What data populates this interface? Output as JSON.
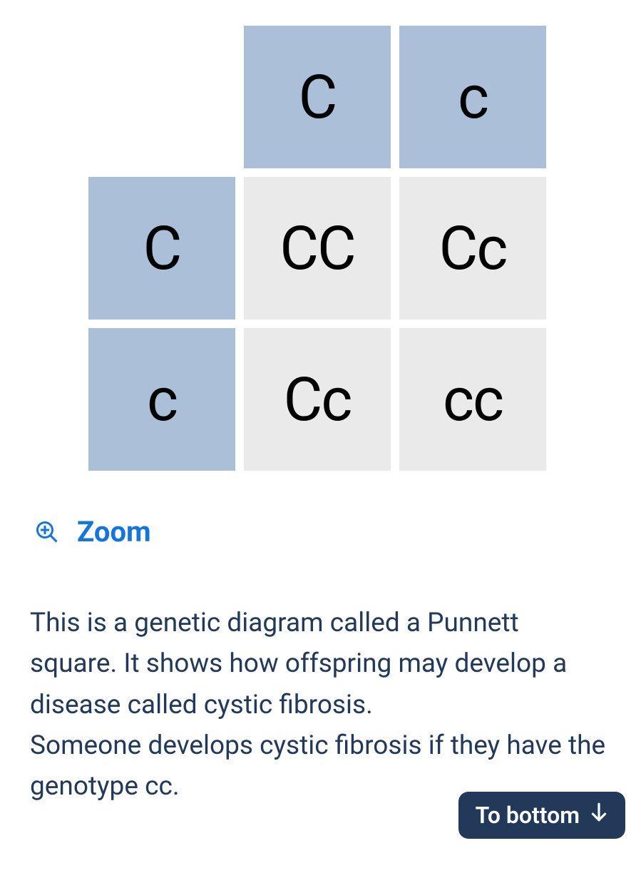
{
  "punnett": {
    "top_col1": "C",
    "top_col2": "c",
    "left_row1": "C",
    "left_row2": "c",
    "r1c1": "CC",
    "r1c2": "Cc",
    "r2c1": "Cc",
    "r2c2": "cc"
  },
  "zoom": {
    "label": "Zoom"
  },
  "body": {
    "paragraph1": "This is a genetic diagram called a Punnett square. It shows how offspring may develop a disease called cystic fibrosis.",
    "paragraph2": "Someone develops cystic fibrosis if they have the genotype cc."
  },
  "to_bottom": {
    "label": "To bottom"
  }
}
